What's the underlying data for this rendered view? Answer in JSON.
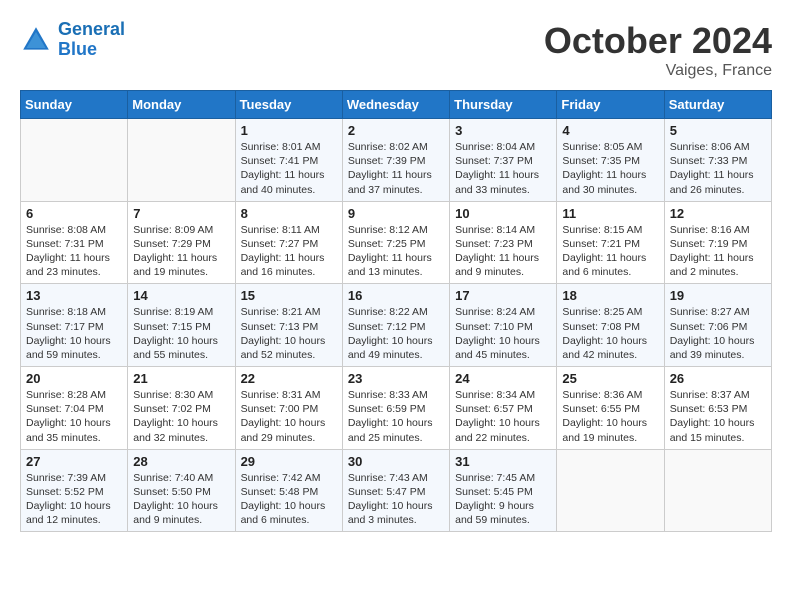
{
  "header": {
    "logo_line1": "General",
    "logo_line2": "Blue",
    "month": "October 2024",
    "location": "Vaiges, France"
  },
  "weekdays": [
    "Sunday",
    "Monday",
    "Tuesday",
    "Wednesday",
    "Thursday",
    "Friday",
    "Saturday"
  ],
  "weeks": [
    [
      {
        "day": "",
        "info": ""
      },
      {
        "day": "",
        "info": ""
      },
      {
        "day": "1",
        "info": "Sunrise: 8:01 AM\nSunset: 7:41 PM\nDaylight: 11 hours and 40 minutes."
      },
      {
        "day": "2",
        "info": "Sunrise: 8:02 AM\nSunset: 7:39 PM\nDaylight: 11 hours and 37 minutes."
      },
      {
        "day": "3",
        "info": "Sunrise: 8:04 AM\nSunset: 7:37 PM\nDaylight: 11 hours and 33 minutes."
      },
      {
        "day": "4",
        "info": "Sunrise: 8:05 AM\nSunset: 7:35 PM\nDaylight: 11 hours and 30 minutes."
      },
      {
        "day": "5",
        "info": "Sunrise: 8:06 AM\nSunset: 7:33 PM\nDaylight: 11 hours and 26 minutes."
      }
    ],
    [
      {
        "day": "6",
        "info": "Sunrise: 8:08 AM\nSunset: 7:31 PM\nDaylight: 11 hours and 23 minutes."
      },
      {
        "day": "7",
        "info": "Sunrise: 8:09 AM\nSunset: 7:29 PM\nDaylight: 11 hours and 19 minutes."
      },
      {
        "day": "8",
        "info": "Sunrise: 8:11 AM\nSunset: 7:27 PM\nDaylight: 11 hours and 16 minutes."
      },
      {
        "day": "9",
        "info": "Sunrise: 8:12 AM\nSunset: 7:25 PM\nDaylight: 11 hours and 13 minutes."
      },
      {
        "day": "10",
        "info": "Sunrise: 8:14 AM\nSunset: 7:23 PM\nDaylight: 11 hours and 9 minutes."
      },
      {
        "day": "11",
        "info": "Sunrise: 8:15 AM\nSunset: 7:21 PM\nDaylight: 11 hours and 6 minutes."
      },
      {
        "day": "12",
        "info": "Sunrise: 8:16 AM\nSunset: 7:19 PM\nDaylight: 11 hours and 2 minutes."
      }
    ],
    [
      {
        "day": "13",
        "info": "Sunrise: 8:18 AM\nSunset: 7:17 PM\nDaylight: 10 hours and 59 minutes."
      },
      {
        "day": "14",
        "info": "Sunrise: 8:19 AM\nSunset: 7:15 PM\nDaylight: 10 hours and 55 minutes."
      },
      {
        "day": "15",
        "info": "Sunrise: 8:21 AM\nSunset: 7:13 PM\nDaylight: 10 hours and 52 minutes."
      },
      {
        "day": "16",
        "info": "Sunrise: 8:22 AM\nSunset: 7:12 PM\nDaylight: 10 hours and 49 minutes."
      },
      {
        "day": "17",
        "info": "Sunrise: 8:24 AM\nSunset: 7:10 PM\nDaylight: 10 hours and 45 minutes."
      },
      {
        "day": "18",
        "info": "Sunrise: 8:25 AM\nSunset: 7:08 PM\nDaylight: 10 hours and 42 minutes."
      },
      {
        "day": "19",
        "info": "Sunrise: 8:27 AM\nSunset: 7:06 PM\nDaylight: 10 hours and 39 minutes."
      }
    ],
    [
      {
        "day": "20",
        "info": "Sunrise: 8:28 AM\nSunset: 7:04 PM\nDaylight: 10 hours and 35 minutes."
      },
      {
        "day": "21",
        "info": "Sunrise: 8:30 AM\nSunset: 7:02 PM\nDaylight: 10 hours and 32 minutes."
      },
      {
        "day": "22",
        "info": "Sunrise: 8:31 AM\nSunset: 7:00 PM\nDaylight: 10 hours and 29 minutes."
      },
      {
        "day": "23",
        "info": "Sunrise: 8:33 AM\nSunset: 6:59 PM\nDaylight: 10 hours and 25 minutes."
      },
      {
        "day": "24",
        "info": "Sunrise: 8:34 AM\nSunset: 6:57 PM\nDaylight: 10 hours and 22 minutes."
      },
      {
        "day": "25",
        "info": "Sunrise: 8:36 AM\nSunset: 6:55 PM\nDaylight: 10 hours and 19 minutes."
      },
      {
        "day": "26",
        "info": "Sunrise: 8:37 AM\nSunset: 6:53 PM\nDaylight: 10 hours and 15 minutes."
      }
    ],
    [
      {
        "day": "27",
        "info": "Sunrise: 7:39 AM\nSunset: 5:52 PM\nDaylight: 10 hours and 12 minutes."
      },
      {
        "day": "28",
        "info": "Sunrise: 7:40 AM\nSunset: 5:50 PM\nDaylight: 10 hours and 9 minutes."
      },
      {
        "day": "29",
        "info": "Sunrise: 7:42 AM\nSunset: 5:48 PM\nDaylight: 10 hours and 6 minutes."
      },
      {
        "day": "30",
        "info": "Sunrise: 7:43 AM\nSunset: 5:47 PM\nDaylight: 10 hours and 3 minutes."
      },
      {
        "day": "31",
        "info": "Sunrise: 7:45 AM\nSunset: 5:45 PM\nDaylight: 9 hours and 59 minutes."
      },
      {
        "day": "",
        "info": ""
      },
      {
        "day": "",
        "info": ""
      }
    ]
  ]
}
